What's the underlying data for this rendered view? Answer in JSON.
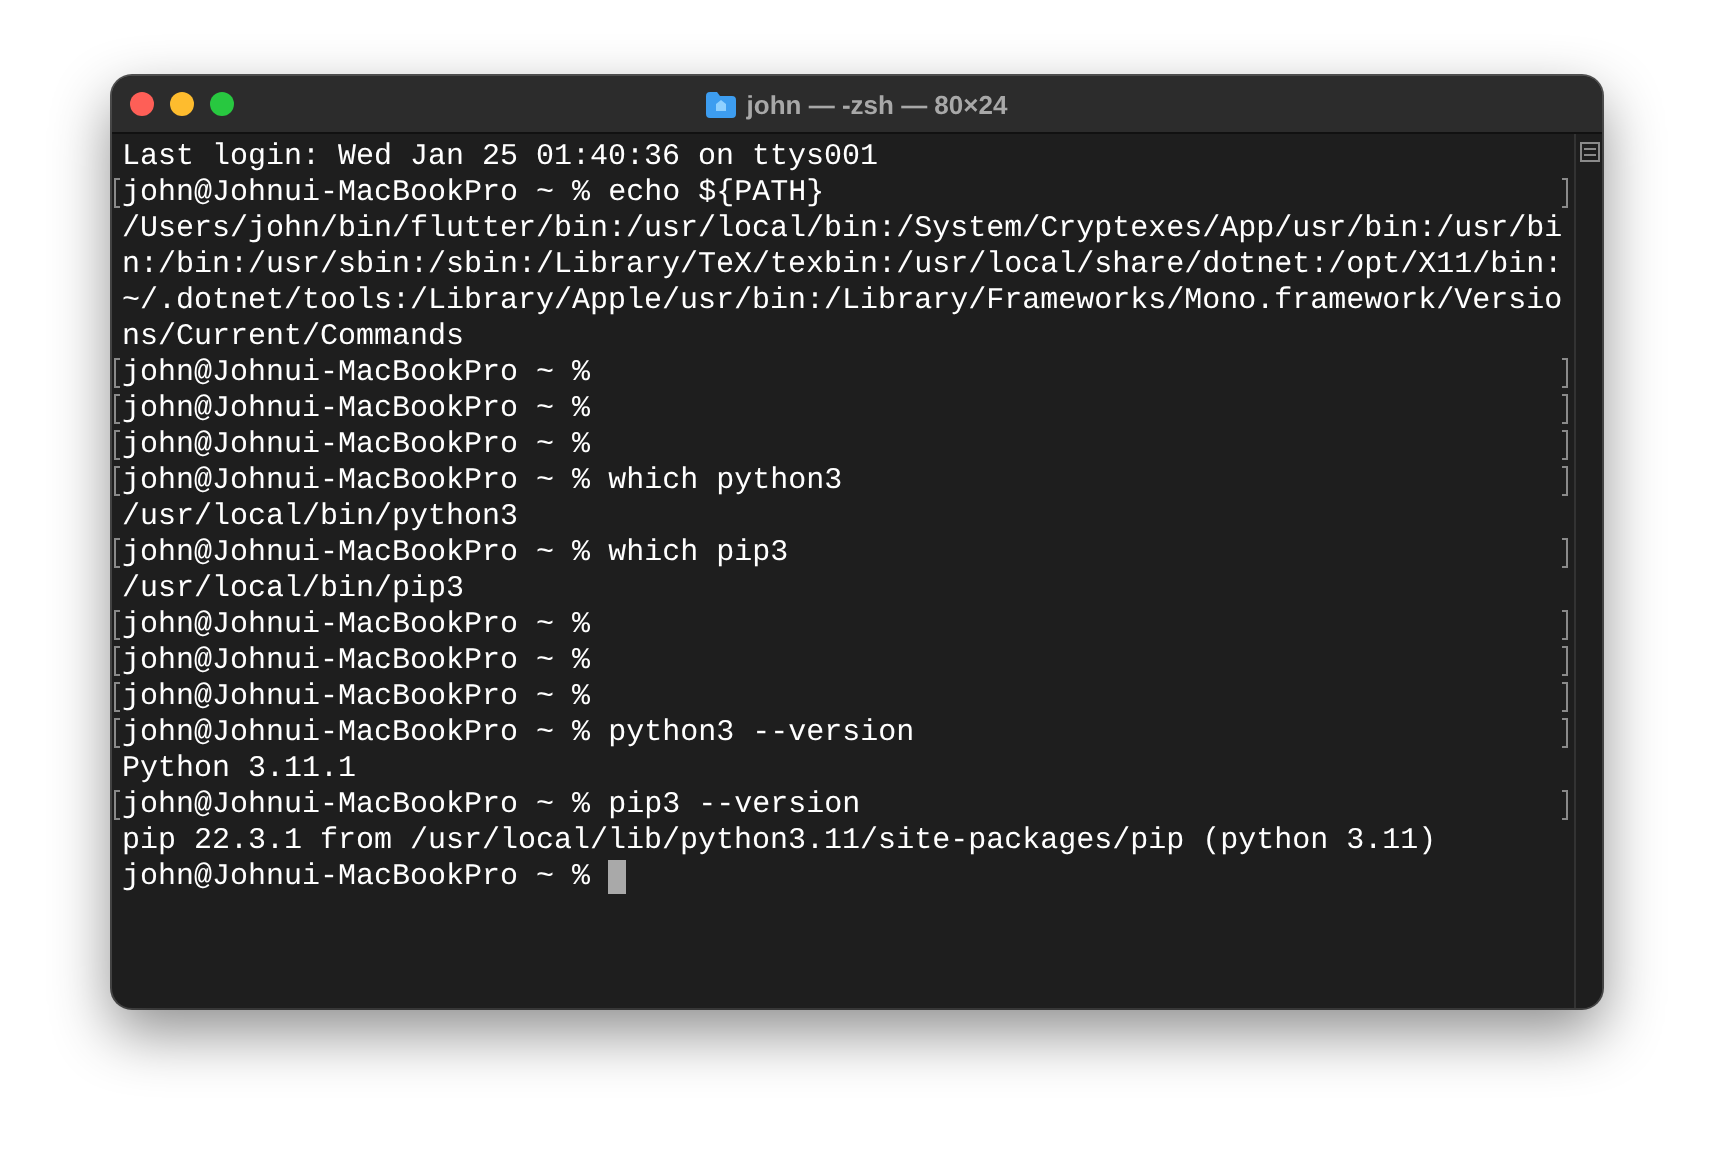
{
  "window": {
    "title": "john — -zsh — 80×24"
  },
  "lines": [
    {
      "kind": "output",
      "text": "Last login: Wed Jan 25 01:40:36 on ttys001",
      "marked": false
    },
    {
      "kind": "prompt",
      "prompt": "john@Johnui-MacBookPro ~ %",
      "command": "echo ${PATH}",
      "marked": true
    },
    {
      "kind": "output",
      "text": "/Users/john/bin/flutter/bin:/usr/local/bin:/System/Cryptexes/App/usr/bin:/usr/bi",
      "marked": false
    },
    {
      "kind": "output",
      "text": "n:/bin:/usr/sbin:/sbin:/Library/TeX/texbin:/usr/local/share/dotnet:/opt/X11/bin:",
      "marked": false
    },
    {
      "kind": "output",
      "text": "~/.dotnet/tools:/Library/Apple/usr/bin:/Library/Frameworks/Mono.framework/Versio",
      "marked": false
    },
    {
      "kind": "output",
      "text": "ns/Current/Commands",
      "marked": false
    },
    {
      "kind": "prompt",
      "prompt": "john@Johnui-MacBookPro ~ %",
      "marked": true
    },
    {
      "kind": "prompt",
      "prompt": "john@Johnui-MacBookPro ~ %",
      "marked": true
    },
    {
      "kind": "prompt",
      "prompt": "john@Johnui-MacBookPro ~ %",
      "marked": true
    },
    {
      "kind": "prompt",
      "prompt": "john@Johnui-MacBookPro ~ %",
      "command": "which python3",
      "marked": true
    },
    {
      "kind": "output",
      "text": "/usr/local/bin/python3",
      "marked": false
    },
    {
      "kind": "prompt",
      "prompt": "john@Johnui-MacBookPro ~ %",
      "command": "which pip3",
      "marked": true
    },
    {
      "kind": "output",
      "text": "/usr/local/bin/pip3",
      "marked": false
    },
    {
      "kind": "prompt",
      "prompt": "john@Johnui-MacBookPro ~ %",
      "marked": true
    },
    {
      "kind": "prompt",
      "prompt": "john@Johnui-MacBookPro ~ %",
      "marked": true
    },
    {
      "kind": "prompt",
      "prompt": "john@Johnui-MacBookPro ~ %",
      "marked": true
    },
    {
      "kind": "prompt",
      "prompt": "john@Johnui-MacBookPro ~ %",
      "command": "python3 --version",
      "marked": true
    },
    {
      "kind": "output",
      "text": "Python 3.11.1",
      "marked": false
    },
    {
      "kind": "prompt",
      "prompt": "john@Johnui-MacBookPro ~ %",
      "command": "pip3 --version",
      "marked": true
    },
    {
      "kind": "output",
      "text": "pip 22.3.1 from /usr/local/lib/python3.11/site-packages/pip (python 3.11)",
      "marked": false
    },
    {
      "kind": "prompt",
      "prompt": "john@Johnui-MacBookPro ~ %",
      "marked": false,
      "cursor": true
    }
  ]
}
